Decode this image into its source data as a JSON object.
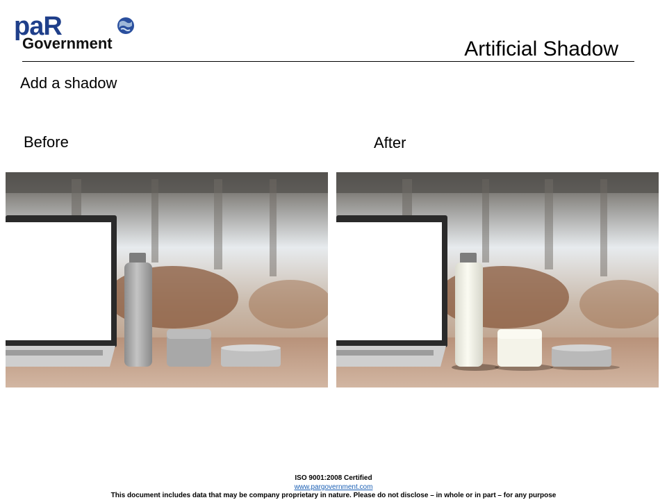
{
  "slide": {
    "title": "Artificial Shadow",
    "subtitle": "Add a shadow",
    "before_label": "Before",
    "after_label": "After"
  },
  "logo": {
    "brand": "PAR",
    "tagline": "Government",
    "colors": {
      "brand_blue": "#1f3f8a",
      "tagline": "#111111"
    }
  },
  "images": {
    "before": {
      "description_icon": "product-photo-no-shadow"
    },
    "after": {
      "description_icon": "product-photo-with-shadow"
    }
  },
  "footer": {
    "certification": "ISO 9001:2008 Certified",
    "website": "www.pargovernment.com",
    "notice": "This document includes data that may be company proprietary in nature. Please do not disclose – in whole or in part – for any purpose"
  }
}
